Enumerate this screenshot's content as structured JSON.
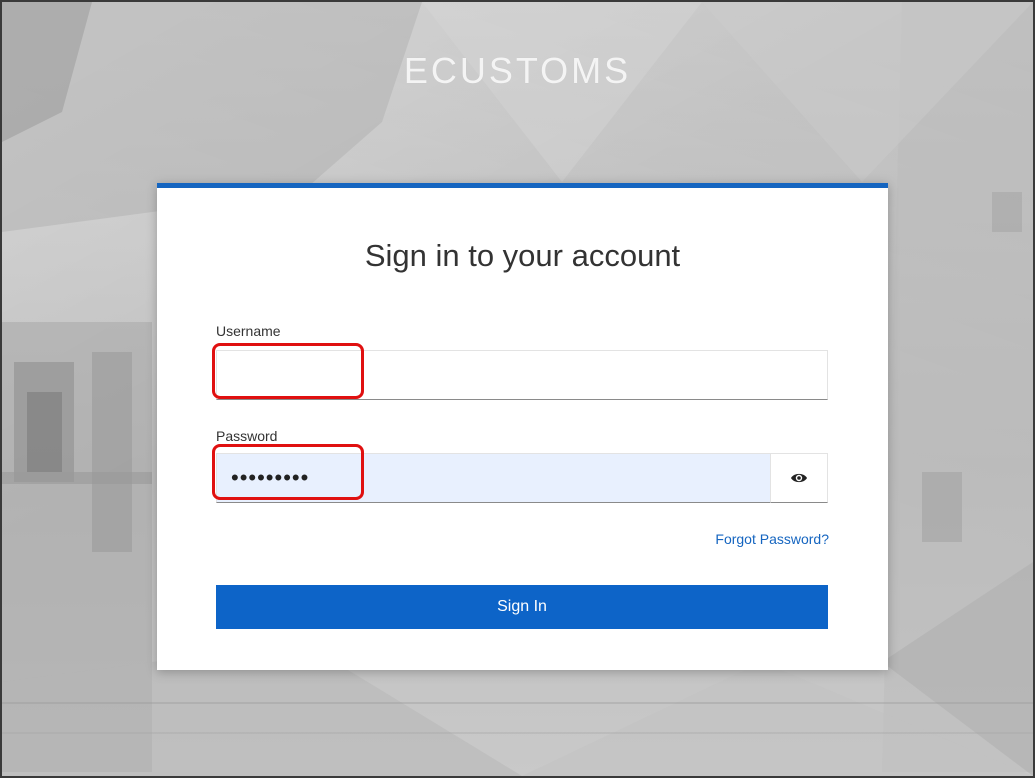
{
  "app": {
    "brand": "ECUSTOMS"
  },
  "login": {
    "title": "Sign in to your account",
    "username_label": "Username",
    "username_value": "",
    "password_label": "Password",
    "password_value": "•••••••••",
    "show_password_icon": "eye-icon",
    "forgot_password": "Forgot Password?",
    "signin_button": "Sign In"
  },
  "colors": {
    "accent": "#0d64c8",
    "link": "#1565c0",
    "autofill": "#e8f0fe",
    "highlight": "#e01010"
  }
}
